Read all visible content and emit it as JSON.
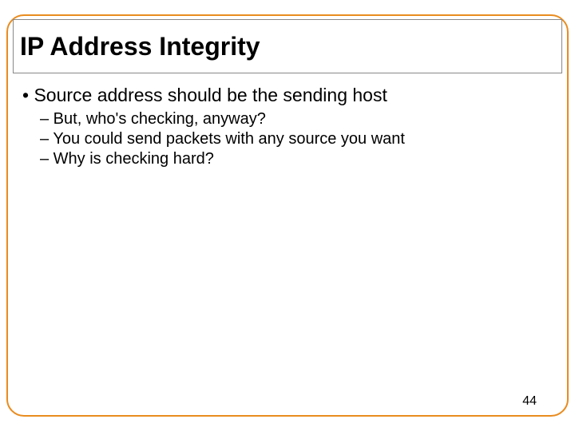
{
  "slide": {
    "title": "IP Address Integrity",
    "bullets": {
      "main": "• Source address should be the sending host",
      "sub1": "– But, who's checking, anyway?",
      "sub2": "– You could send packets with any source you want",
      "sub3": "– Why is checking hard?"
    },
    "page_number": "44"
  }
}
